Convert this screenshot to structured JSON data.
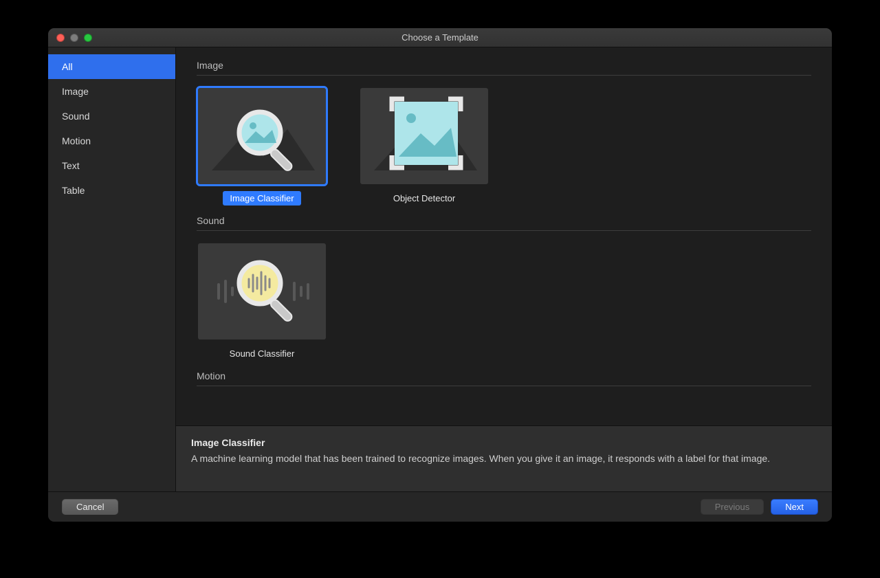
{
  "window": {
    "title": "Choose a Template"
  },
  "sidebar": {
    "items": [
      {
        "label": "All",
        "selected": true
      },
      {
        "label": "Image",
        "selected": false
      },
      {
        "label": "Sound",
        "selected": false
      },
      {
        "label": "Motion",
        "selected": false
      },
      {
        "label": "Text",
        "selected": false
      },
      {
        "label": "Table",
        "selected": false
      }
    ]
  },
  "sections": {
    "image": {
      "title": "Image",
      "tiles": [
        {
          "label": "Image Classifier",
          "icon": "image-classifier-icon",
          "selected": true
        },
        {
          "label": "Object Detector",
          "icon": "object-detector-icon",
          "selected": false
        }
      ]
    },
    "sound": {
      "title": "Sound",
      "tiles": [
        {
          "label": "Sound Classifier",
          "icon": "sound-classifier-icon",
          "selected": false
        }
      ]
    },
    "motion": {
      "title": "Motion"
    }
  },
  "detail": {
    "title": "Image Classifier",
    "body": "A machine learning model that has been trained to recognize images. When you give it an image, it responds with a label for that image."
  },
  "footer": {
    "cancel": "Cancel",
    "previous": "Previous",
    "next": "Next"
  }
}
